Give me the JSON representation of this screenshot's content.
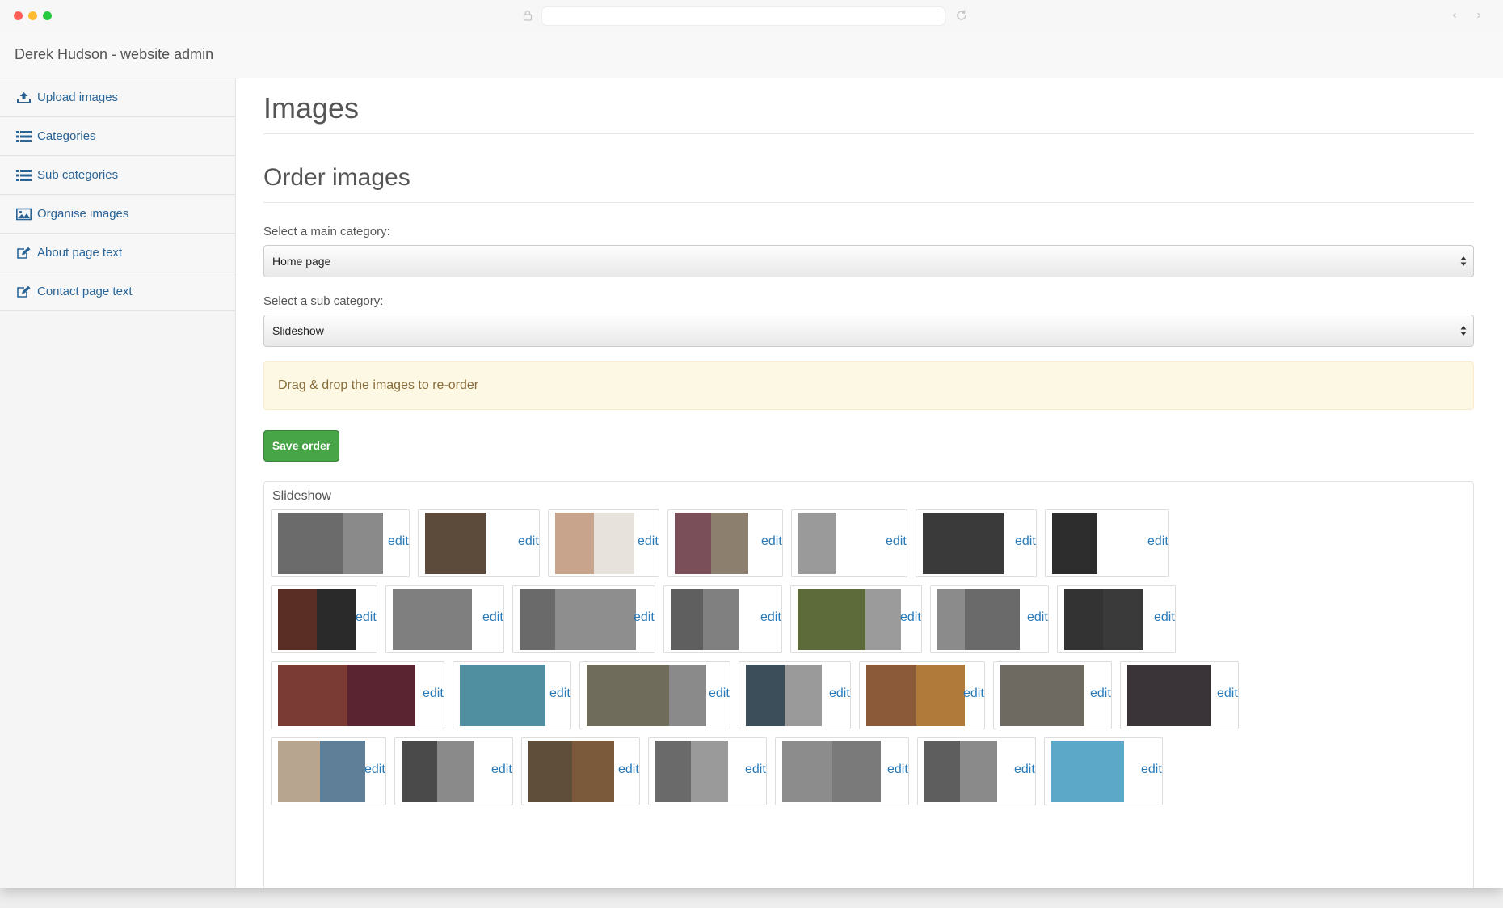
{
  "app": {
    "brand": "Derek Hudson - website admin"
  },
  "sidebar": {
    "items": [
      {
        "label": "Upload images",
        "icon": "upload-icon"
      },
      {
        "label": "Categories",
        "icon": "list-icon"
      },
      {
        "label": "Sub categories",
        "icon": "list-icon"
      },
      {
        "label": "Organise images",
        "icon": "picture-icon"
      },
      {
        "label": "About page text",
        "icon": "edit-icon"
      },
      {
        "label": "Contact page text",
        "icon": "edit-icon"
      }
    ]
  },
  "main": {
    "title": "Images",
    "section_title": "Order images",
    "main_category_label": "Select a main category:",
    "main_category_value": "Home page",
    "sub_category_label": "Select a sub category:",
    "sub_category_value": "Slideshow",
    "alert": "Drag & drop the images to re-order",
    "save_label": "Save order",
    "panel_title": "Slideshow",
    "edit_label": "edit"
  },
  "colors": {
    "link": "#2a7ab8",
    "success": "#47a447",
    "alert_bg": "#fcf8e3",
    "alert_text": "#8a6d3b"
  }
}
